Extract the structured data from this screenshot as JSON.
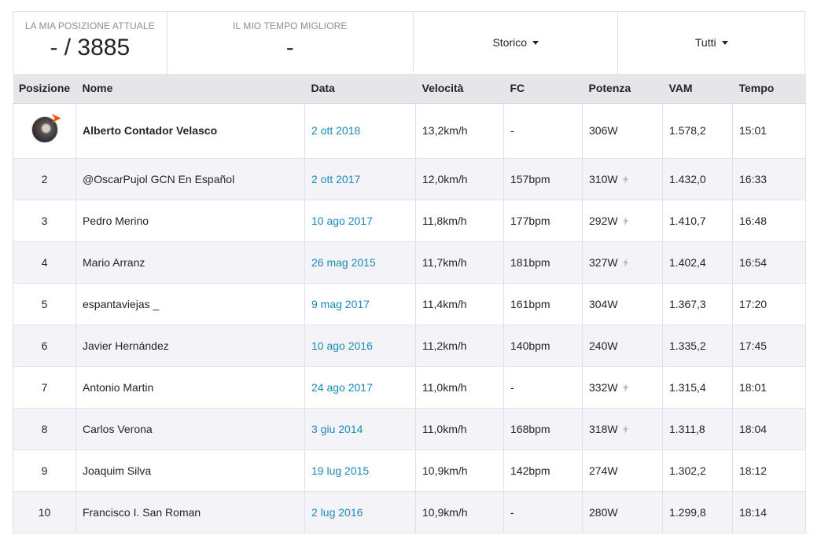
{
  "summary": {
    "current_position_label": "LA MIA POSIZIONE ATTUALE",
    "current_position_value": "- / 3885",
    "best_time_label": "IL MIO TEMPO MIGLIORE",
    "best_time_value": "-",
    "filter_history": "Storico",
    "filter_all": "Tutti"
  },
  "table": {
    "headers": [
      "Posizione",
      "Nome",
      "Data",
      "Velocità",
      "FC",
      "Potenza",
      "VAM",
      "Tempo"
    ],
    "rows": [
      {
        "pos": "",
        "name": "Alberto Contador Velasco",
        "date": "2 ott 2018",
        "speed": "13,2km/h",
        "hr": "-",
        "power": "306W",
        "vam": "1.578,2",
        "time": "15:01",
        "power_meter": false
      },
      {
        "pos": "2",
        "name": "@OscarPujol GCN En Español",
        "date": "2 ott 2017",
        "speed": "12,0km/h",
        "hr": "157bpm",
        "power": "310W",
        "vam": "1.432,0",
        "time": "16:33",
        "power_meter": true
      },
      {
        "pos": "3",
        "name": "Pedro Merino",
        "date": "10 ago 2017",
        "speed": "11,8km/h",
        "hr": "177bpm",
        "power": "292W",
        "vam": "1.410,7",
        "time": "16:48",
        "power_meter": true
      },
      {
        "pos": "4",
        "name": "Mario Arranz",
        "date": "26 mag 2015",
        "speed": "11,7km/h",
        "hr": "181bpm",
        "power": "327W",
        "vam": "1.402,4",
        "time": "16:54",
        "power_meter": true
      },
      {
        "pos": "5",
        "name": "espantaviejas _",
        "date": "9 mag 2017",
        "speed": "11,4km/h",
        "hr": "161bpm",
        "power": "304W",
        "vam": "1.367,3",
        "time": "17:20",
        "power_meter": false
      },
      {
        "pos": "6",
        "name": "Javier Hernández",
        "date": "10 ago 2016",
        "speed": "11,2km/h",
        "hr": "140bpm",
        "power": "240W",
        "vam": "1.335,2",
        "time": "17:45",
        "power_meter": false
      },
      {
        "pos": "7",
        "name": "Antonio Martin",
        "date": "24 ago 2017",
        "speed": "11,0km/h",
        "hr": "-",
        "power": "332W",
        "vam": "1.315,4",
        "time": "18:01",
        "power_meter": true
      },
      {
        "pos": "8",
        "name": "Carlos Verona",
        "date": "3 giu 2014",
        "speed": "11,0km/h",
        "hr": "168bpm",
        "power": "318W",
        "vam": "1.311,8",
        "time": "18:04",
        "power_meter": true
      },
      {
        "pos": "9",
        "name": "Joaquim Silva",
        "date": "19 lug 2015",
        "speed": "10,9km/h",
        "hr": "142bpm",
        "power": "274W",
        "vam": "1.302,2",
        "time": "18:12",
        "power_meter": false
      },
      {
        "pos": "10",
        "name": "Francisco I. San Roman",
        "date": "2 lug 2016",
        "speed": "10,9km/h",
        "hr": "-",
        "power": "280W",
        "vam": "1.299,8",
        "time": "18:14",
        "power_meter": false
      }
    ]
  },
  "colors": {
    "link": "#1a8ab6",
    "header_bg": "#e6e6ea",
    "alt_row_bg": "#f4f4f8",
    "brand_orange": "#fc5200"
  }
}
